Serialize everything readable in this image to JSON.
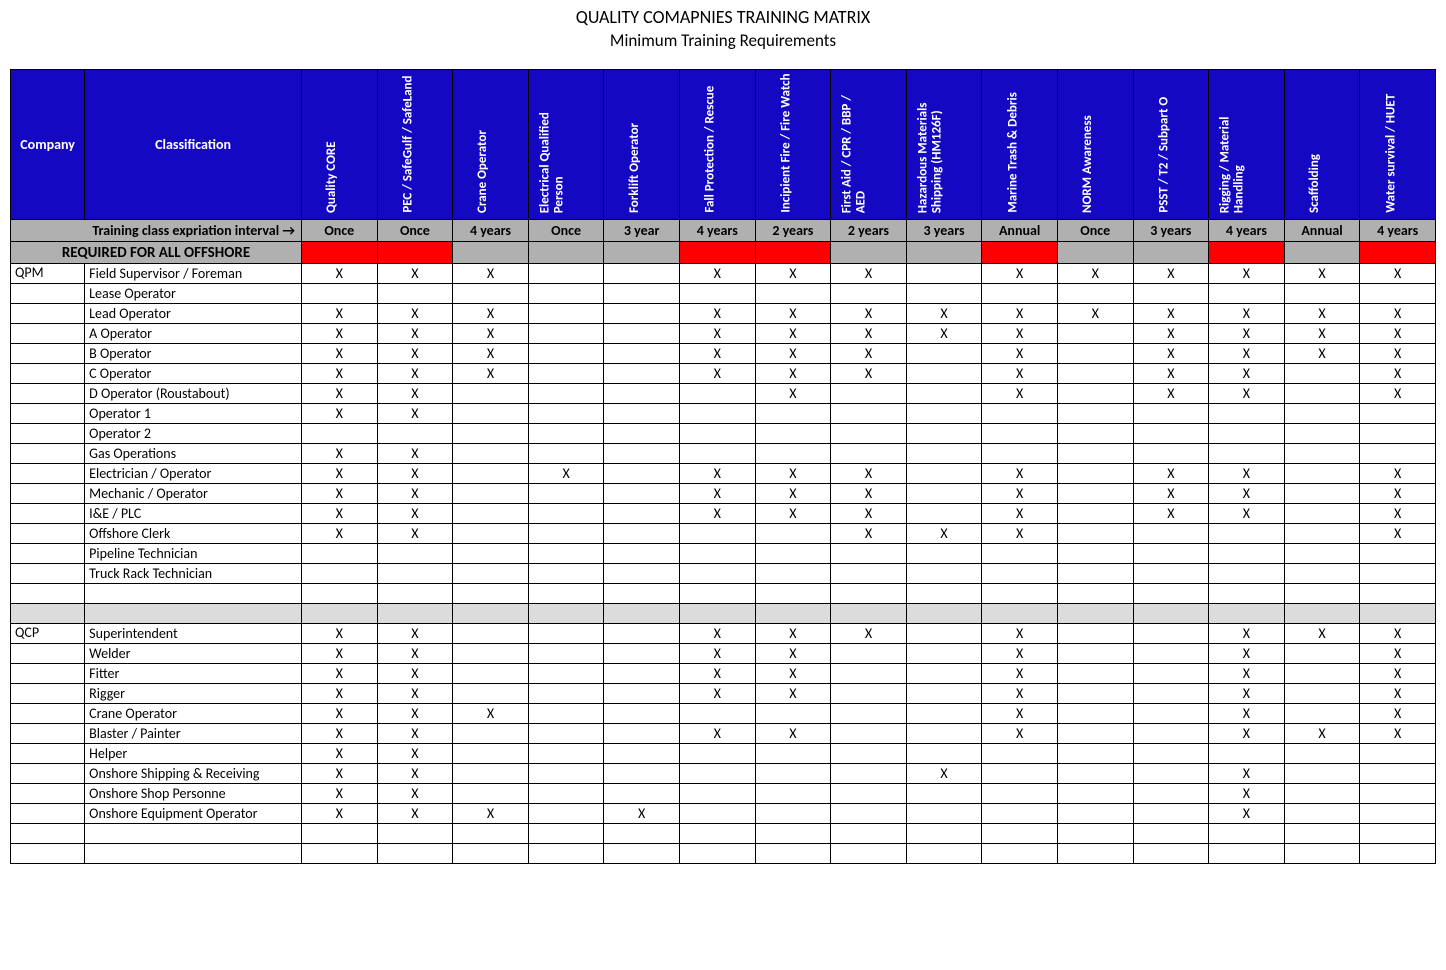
{
  "header": {
    "title": "QUALITY COMAPNIES TRAINING MATRIX",
    "subtitle": "Minimum Training Requirements"
  },
  "columns": {
    "company": "Company",
    "classification": "Classification",
    "trainings": [
      "Quality CORE",
      "PEC / SafeGulf / SafeLand",
      "Crane Operator",
      "Electrical Qualified Person",
      "Forklift Operator",
      "Fall Protection / Rescue",
      "Incipient Fire / Fire Watch",
      "First Aid / CPR / BBP / AED",
      "Hazardous Materials Shipping (HM126F)",
      "Marine Trash & Debris",
      "NORM Awareness",
      "PSST / T2 / Subpart O",
      "Rigging / Material Handling",
      "Scaffolding",
      "Water survival / HUET"
    ]
  },
  "interval": {
    "label": "Training class expriation interval   →",
    "values": [
      "Once",
      "Once",
      "4 years",
      "Once",
      "3 year",
      "4 years",
      "2 years",
      "2 years",
      "3 years",
      "Annual",
      "Once",
      "3 years",
      "4 years",
      "Annual",
      "4 years"
    ]
  },
  "required": {
    "label": "REQUIRED FOR ALL OFFSHORE",
    "flags": [
      true,
      true,
      false,
      false,
      false,
      true,
      true,
      false,
      false,
      true,
      false,
      false,
      true,
      false,
      true
    ]
  },
  "sections": [
    {
      "company": "QPM",
      "rows": [
        {
          "class": "Field Supervisor / Foreman",
          "marks": [
            "X",
            "X",
            "X",
            "",
            "",
            "X",
            "X",
            "X",
            "",
            "X",
            "X",
            "X",
            "X",
            "X",
            "X"
          ]
        },
        {
          "class": "Lease Operator",
          "marks": [
            "",
            "",
            "",
            "",
            "",
            "",
            "",
            "",
            "",
            "",
            "",
            "",
            "",
            "",
            ""
          ]
        },
        {
          "class": "Lead Operator",
          "marks": [
            "X",
            "X",
            "X",
            "",
            "",
            "X",
            "X",
            "X",
            "X",
            "X",
            "X",
            "X",
            "X",
            "X",
            "X"
          ]
        },
        {
          "class": "A Operator",
          "marks": [
            "X",
            "X",
            "X",
            "",
            "",
            "X",
            "X",
            "X",
            "X",
            "X",
            "",
            "X",
            "X",
            "X",
            "X"
          ]
        },
        {
          "class": "B Operator",
          "marks": [
            "X",
            "X",
            "X",
            "",
            "",
            "X",
            "X",
            "X",
            "",
            "X",
            "",
            "X",
            "X",
            "X",
            "X"
          ]
        },
        {
          "class": "C Operator",
          "marks": [
            "X",
            "X",
            "X",
            "",
            "",
            "X",
            "X",
            "X",
            "",
            "X",
            "",
            "X",
            "X",
            "",
            "X"
          ]
        },
        {
          "class": "D Operator (Roustabout)",
          "marks": [
            "X",
            "X",
            "",
            "",
            "",
            "",
            "X",
            "",
            "",
            "X",
            "",
            "X",
            "X",
            "",
            "X"
          ]
        },
        {
          "class": "Operator 1",
          "marks": [
            "X",
            "X",
            "",
            "",
            "",
            "",
            "",
            "",
            "",
            "",
            "",
            "",
            "",
            "",
            ""
          ]
        },
        {
          "class": "Operator 2",
          "marks": [
            "",
            "",
            "",
            "",
            "",
            "",
            "",
            "",
            "",
            "",
            "",
            "",
            "",
            "",
            ""
          ]
        },
        {
          "class": "Gas Operations",
          "marks": [
            "X",
            "X",
            "",
            "",
            "",
            "",
            "",
            "",
            "",
            "",
            "",
            "",
            "",
            "",
            ""
          ]
        },
        {
          "class": "Electrician / Operator",
          "marks": [
            "X",
            "X",
            "",
            "X",
            "",
            "X",
            "X",
            "X",
            "",
            "X",
            "",
            "X",
            "X",
            "",
            "X"
          ]
        },
        {
          "class": "Mechanic / Operator",
          "marks": [
            "X",
            "X",
            "",
            "",
            "",
            "X",
            "X",
            "X",
            "",
            "X",
            "",
            "X",
            "X",
            "",
            "X"
          ]
        },
        {
          "class": "I&E / PLC",
          "marks": [
            "X",
            "X",
            "",
            "",
            "",
            "X",
            "X",
            "X",
            "",
            "X",
            "",
            "X",
            "X",
            "",
            "X"
          ]
        },
        {
          "class": "Offshore Clerk",
          "marks": [
            "X",
            "X",
            "",
            "",
            "",
            "",
            "",
            "X",
            "X",
            "X",
            "",
            "",
            "",
            "",
            "X"
          ]
        },
        {
          "class": "Pipeline Technician",
          "marks": [
            "",
            "",
            "",
            "",
            "",
            "",
            "",
            "",
            "",
            "",
            "",
            "",
            "",
            "",
            ""
          ]
        },
        {
          "class": "Truck Rack Technician",
          "marks": [
            "",
            "",
            "",
            "",
            "",
            "",
            "",
            "",
            "",
            "",
            "",
            "",
            "",
            "",
            ""
          ]
        }
      ]
    },
    {
      "company": "QCP",
      "rows": [
        {
          "class": "Superintendent",
          "marks": [
            "X",
            "X",
            "",
            "",
            "",
            "X",
            "X",
            "X",
            "",
            "X",
            "",
            "",
            "X",
            "X",
            "X"
          ]
        },
        {
          "class": "Welder",
          "marks": [
            "X",
            "X",
            "",
            "",
            "",
            "X",
            "X",
            "",
            "",
            "X",
            "",
            "",
            "X",
            "",
            "X"
          ]
        },
        {
          "class": "Fitter",
          "marks": [
            "X",
            "X",
            "",
            "",
            "",
            "X",
            "X",
            "",
            "",
            "X",
            "",
            "",
            "X",
            "",
            "X"
          ]
        },
        {
          "class": "Rigger",
          "marks": [
            "X",
            "X",
            "",
            "",
            "",
            "X",
            "X",
            "",
            "",
            "X",
            "",
            "",
            "X",
            "",
            "X"
          ]
        },
        {
          "class": "Crane Operator",
          "marks": [
            "X",
            "X",
            "X",
            "",
            "",
            "",
            "",
            "",
            "",
            "X",
            "",
            "",
            "X",
            "",
            "X"
          ]
        },
        {
          "class": "Blaster / Painter",
          "marks": [
            "X",
            "X",
            "",
            "",
            "",
            "X",
            "X",
            "",
            "",
            "X",
            "",
            "",
            "X",
            "X",
            "X"
          ]
        },
        {
          "class": "Helper",
          "marks": [
            "X",
            "X",
            "",
            "",
            "",
            "",
            "",
            "",
            "",
            "",
            "",
            "",
            "",
            "",
            ""
          ]
        },
        {
          "class": "Onshore Shipping & Receiving",
          "marks": [
            "X",
            "X",
            "",
            "",
            "",
            "",
            "",
            "",
            "X",
            "",
            "",
            "",
            "X",
            "",
            ""
          ]
        },
        {
          "class": "Onshore Shop Personne",
          "marks": [
            "X",
            "X",
            "",
            "",
            "",
            "",
            "",
            "",
            "",
            "",
            "",
            "",
            "X",
            "",
            ""
          ]
        },
        {
          "class": "Onshore Equipment Operator",
          "marks": [
            "X",
            "X",
            "X",
            "",
            "X",
            "",
            "",
            "",
            "",
            "",
            "",
            "",
            "X",
            "",
            ""
          ]
        }
      ]
    }
  ]
}
